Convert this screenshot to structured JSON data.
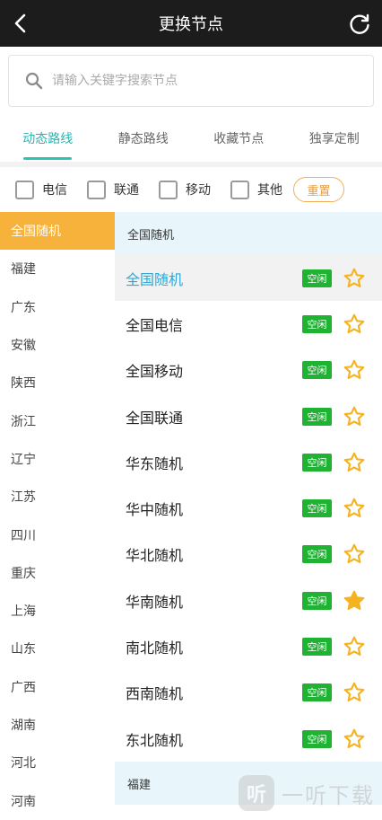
{
  "header": {
    "title": "更换节点"
  },
  "search": {
    "placeholder": "请输入关键字搜索节点"
  },
  "tabs": [
    {
      "label": "动态路线",
      "active": true
    },
    {
      "label": "静态路线",
      "active": false
    },
    {
      "label": "收藏节点",
      "active": false
    },
    {
      "label": "独享定制",
      "active": false
    }
  ],
  "filters": {
    "items": [
      "电信",
      "联通",
      "移动",
      "其他"
    ],
    "reset_label": "重置"
  },
  "provinces": [
    "全国随机",
    "福建",
    "广东",
    "安徽",
    "陕西",
    "浙江",
    "辽宁",
    "江苏",
    "四川",
    "重庆",
    "上海",
    "山东",
    "广西",
    "湖南",
    "河北",
    "河南"
  ],
  "groups": [
    {
      "title": "全国随机",
      "nodes": [
        {
          "name": "全国随机",
          "status": "空闲",
          "fav": false
        },
        {
          "name": "全国电信",
          "status": "空闲",
          "fav": false
        },
        {
          "name": "全国移动",
          "status": "空闲",
          "fav": false
        },
        {
          "name": "全国联通",
          "status": "空闲",
          "fav": false
        },
        {
          "name": "华东随机",
          "status": "空闲",
          "fav": false
        },
        {
          "name": "华中随机",
          "status": "空闲",
          "fav": false
        },
        {
          "name": "华北随机",
          "status": "空闲",
          "fav": false
        },
        {
          "name": "华南随机",
          "status": "空闲",
          "fav": true
        },
        {
          "name": "南北随机",
          "status": "空闲",
          "fav": false
        },
        {
          "name": "西南随机",
          "status": "空闲",
          "fav": false
        },
        {
          "name": "东北随机",
          "status": "空闲",
          "fav": false
        }
      ]
    },
    {
      "title": "福建",
      "nodes": []
    }
  ],
  "watermark": {
    "logo": "听",
    "text": "一听下载"
  },
  "colors": {
    "accent": "#27b5b0",
    "active_province": "#f7b23b",
    "badge": "#1fb233",
    "star": "#f5b321",
    "group_bg": "#e8f6fb",
    "active_node_text": "#2ea8d7"
  }
}
